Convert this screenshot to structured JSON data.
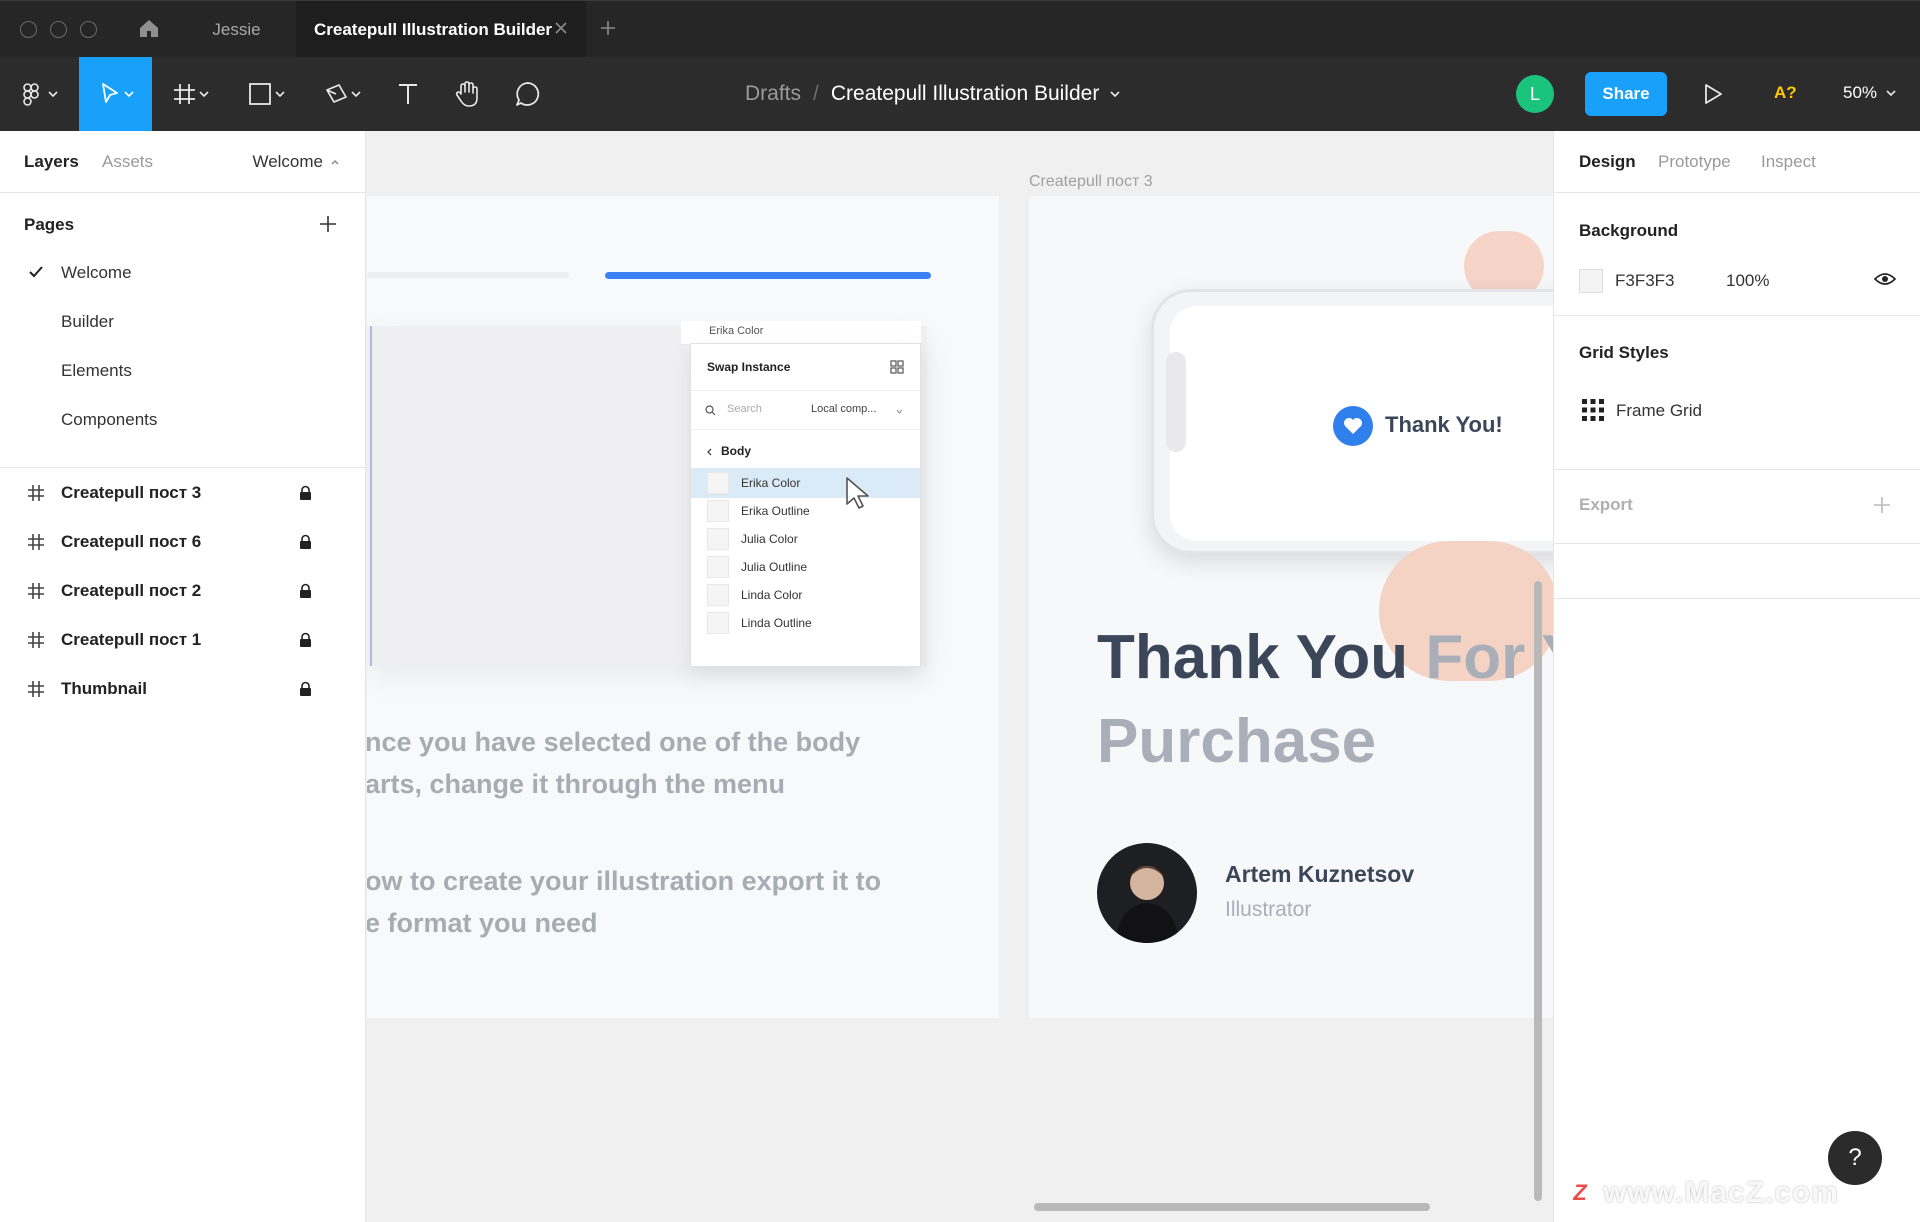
{
  "tabbar": {
    "tabs": [
      {
        "label": "Jessie",
        "active": false
      },
      {
        "label": "Createpull Illustration Builder",
        "active": true
      }
    ]
  },
  "toolbar": {
    "breadcrumb_parent": "Drafts",
    "breadcrumb_separator": "/",
    "file_name": "Createpull Illustration Builder",
    "user_initial": "L",
    "share_label": "Share",
    "a11y_label": "A?",
    "zoom_label": "50%",
    "accent_color": "#18a0fb"
  },
  "left_panel": {
    "tab_layers": "Layers",
    "tab_assets": "Assets",
    "current_page": "Welcome",
    "pages_heading": "Pages",
    "pages": [
      {
        "label": "Welcome",
        "selected": true
      },
      {
        "label": "Builder",
        "selected": false
      },
      {
        "label": "Elements",
        "selected": false
      },
      {
        "label": "Components",
        "selected": false
      }
    ],
    "layers": [
      {
        "label": "Createpull пост 3",
        "locked": true
      },
      {
        "label": "Createpull пост 6",
        "locked": true
      },
      {
        "label": "Createpull пост 2",
        "locked": true
      },
      {
        "label": "Createpull пост 1",
        "locked": true
      },
      {
        "label": "Thumbnail",
        "locked": true
      }
    ]
  },
  "canvas": {
    "frame_b_label": "Createpull пост 3",
    "swap": {
      "top_label": "Erika Color",
      "title": "Swap Instance",
      "search_placeholder": "Search",
      "library_select": "Local comp...",
      "group": "Body",
      "items": [
        {
          "label": "Erika Color",
          "selected": true
        },
        {
          "label": "Erika Outline",
          "selected": false
        },
        {
          "label": "Julia Color",
          "selected": false
        },
        {
          "label": "Julia Outline",
          "selected": false
        },
        {
          "label": "Linda Color",
          "selected": false
        },
        {
          "label": "Linda Outline",
          "selected": false
        }
      ]
    },
    "frame_a_text": [
      "nce you have selected one of the body",
      "arts, change it through the menu",
      "ow to create your illustration export it to",
      "e format you need"
    ],
    "thank_you_label": "Thank You!",
    "headline_dark": "Thank You",
    "headline_light": "For Y",
    "headline_line2": "Purchase",
    "author_name": "Artem Kuznetsov",
    "author_role": "Illustrator"
  },
  "right_panel": {
    "tab_design": "Design",
    "tab_prototype": "Prototype",
    "tab_inspect": "Inspect",
    "background_heading": "Background",
    "background_hex": "F3F3F3",
    "background_opacity": "100%",
    "grid_styles_heading": "Grid Styles",
    "grid_style_name": "Frame Grid",
    "export_heading": "Export"
  },
  "help": "?",
  "watermark": {
    "badge": "Z",
    "text": "www.MacZ.com"
  }
}
